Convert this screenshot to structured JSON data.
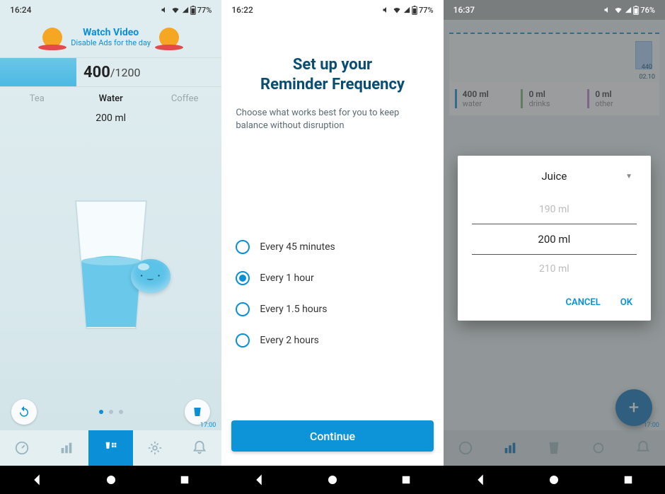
{
  "screen1": {
    "status": {
      "time": "16:24",
      "battery": "77%"
    },
    "ad": {
      "title": "Watch Video",
      "subtitle": "Disable Ads for the day"
    },
    "progress": {
      "current": "400",
      "separator": "/",
      "goal": "1200"
    },
    "tabs": {
      "tea": "Tea",
      "water": "Water",
      "coffee": "Coffee"
    },
    "amount": "200 ml",
    "nav_time": "17:00"
  },
  "screen2": {
    "status": {
      "time": "16:22",
      "battery": "77%"
    },
    "title_line1": "Set up your",
    "title_line2": "Reminder Frequency",
    "subtitle": "Choose what works best for you to keep balance without disruption",
    "options": [
      {
        "label": "Every 45 minutes",
        "checked": false
      },
      {
        "label": "Every 1 hour",
        "checked": true
      },
      {
        "label": "Every 1.5 hours",
        "checked": false
      },
      {
        "label": "Every 2 hours",
        "checked": false
      }
    ],
    "continue": "Continue"
  },
  "screen3": {
    "status": {
      "time": "16:37",
      "battery": "76%"
    },
    "chart": {
      "bar_value": "440",
      "bar_time": "02.10"
    },
    "stats": [
      {
        "value": "400 ml",
        "label": "water",
        "color": "#0b8fd6"
      },
      {
        "value": "0 ml",
        "label": "drinks",
        "color": "#6fb86f"
      },
      {
        "value": "0 ml",
        "label": "other",
        "color": "#b97fd8"
      }
    ],
    "dialog": {
      "dropdown": "Juice",
      "picker": {
        "prev": "190 ml",
        "current": "200 ml",
        "next": "210 ml"
      },
      "cancel": "CANCEL",
      "ok": "OK"
    },
    "nav_time": "17:00"
  }
}
